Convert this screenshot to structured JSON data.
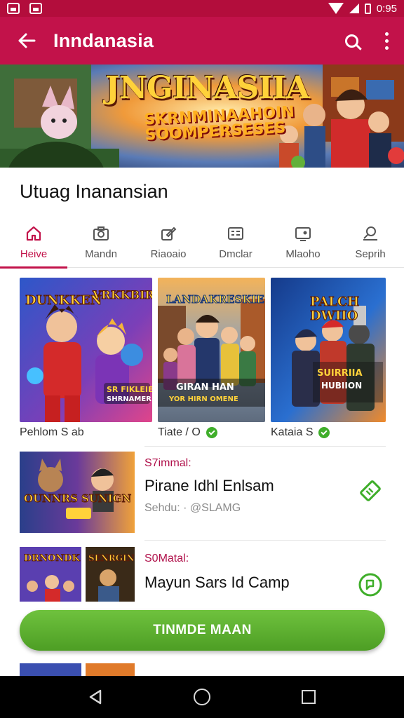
{
  "status_bar": {
    "time": "0:95"
  },
  "app_bar": {
    "title": "Inndanasia"
  },
  "banner": {
    "title": "JNGINASIIA",
    "subtitle_line1": "SKRNMINAAHOIN",
    "subtitle_line2": "SOOMPERSESES"
  },
  "page_title": "Utuag Inanansian",
  "tabs": [
    {
      "label": "Heive",
      "icon": "home-icon",
      "active": true
    },
    {
      "label": "Mandn",
      "icon": "camera-icon",
      "active": false
    },
    {
      "label": "Riaoaio",
      "icon": "edit-icon",
      "active": false
    },
    {
      "label": "Dmclar",
      "icon": "list-icon",
      "active": false
    },
    {
      "label": "Mlaoho",
      "icon": "tv-icon",
      "active": false
    },
    {
      "label": "Seprih",
      "icon": "search-person-icon",
      "active": false
    }
  ],
  "grid_cards": [
    {
      "label": "Pehlom S ab",
      "verified": false,
      "art_top": "DUNKKEN",
      "art_top2": "VRKKBIRE",
      "art_bottom1": "SR FIKLEIE",
      "art_bottom2": "SHRNAMER"
    },
    {
      "label": "Tiate / O",
      "verified": true,
      "art_top": "LANDAKRESKIE",
      "art_bottom1": "GIRAN HAN",
      "art_bottom2": "YOR HIRN OMENE"
    },
    {
      "label": "Kataia S",
      "verified": true,
      "art_top": "PALCH",
      "art_top2": "DWIIO",
      "art_bottom1": "SUIRRIIA",
      "art_bottom2": "HUBIION"
    }
  ],
  "list_items": [
    {
      "tag": "S7immal:",
      "title": "Pirane Idhl Enlsam",
      "meta": "Sehdu: · @SLAMG",
      "thumb_left": "OUNNRS",
      "thumb_right": "SUNIGN",
      "action_icon": "ticket-icon"
    },
    {
      "tag": "S0Matal:",
      "title": "Mayun Sars Id Camp",
      "meta": "",
      "thumb_left": "DRNONDK",
      "thumb_right": "SENRGIN",
      "action_icon": "chat-icon"
    }
  ],
  "cta": {
    "label": "TINMDE MAAN"
  },
  "colors": {
    "accent": "#c2124a",
    "status_bar": "#b30d3c",
    "cta": "#5fb131"
  }
}
